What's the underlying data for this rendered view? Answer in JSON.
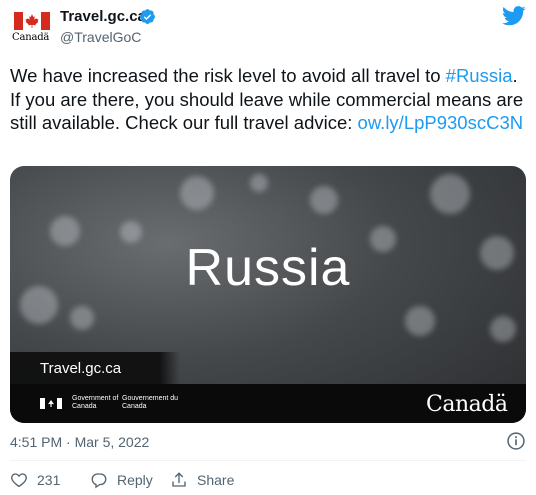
{
  "account": {
    "display_name": "Travel.gc.ca",
    "handle": "@TravelGoC",
    "logo_wordmark": "Canadä",
    "verified": true
  },
  "tweet": {
    "text_before": "We have increased the risk level to avoid all travel to ",
    "hashtag": "#Russia",
    "text_after": ". If you are there, you should leave while commercial means are still available. Check our full travel advice: ",
    "link": "ow.ly/LpP930scC3N"
  },
  "media": {
    "title": "Russia",
    "site": "Travel.gc.ca",
    "gov_en": "Government of Canada",
    "gov_fr": "Gouvernement du Canada",
    "wordmark": "Canadä"
  },
  "timestamp": "4:51 PM · Mar 5, 2022",
  "actions": {
    "like_count": "231",
    "reply_label": "Reply",
    "share_label": "Share"
  },
  "colors": {
    "link": "#1d9bf0",
    "flag_red": "#d52b1e",
    "secondary_text": "#536471"
  },
  "icons": [
    "canada-flag-icon",
    "verified-icon",
    "twitter-bird-icon",
    "info-icon",
    "heart-icon",
    "reply-icon",
    "share-icon"
  ]
}
